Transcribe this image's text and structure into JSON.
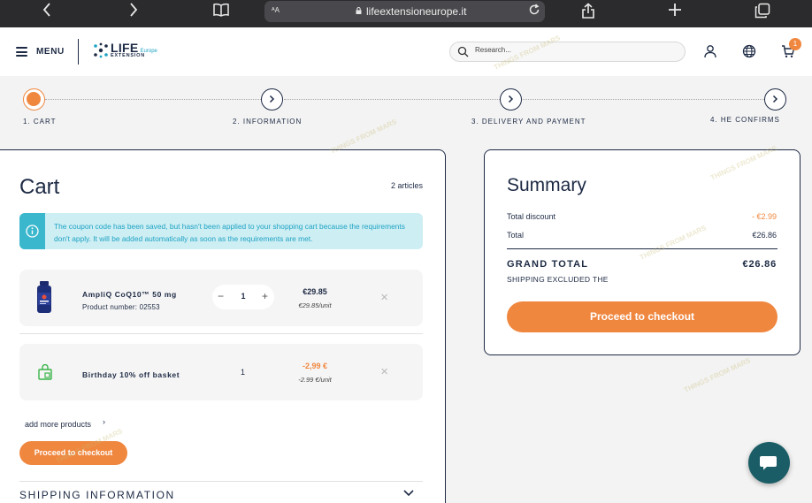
{
  "browser": {
    "url": "lifeextensioneurope.it",
    "aa_label": "ᴬA"
  },
  "header": {
    "menu_label": "MENU",
    "logo_life": "LIFE",
    "logo_europe": "Europe",
    "logo_extension": "EXTENSION",
    "search_placeholder": "Research...",
    "cart_count": "1"
  },
  "stepper": {
    "steps": [
      {
        "label": "1. CART",
        "state": "active"
      },
      {
        "label": "2. INFORMATION",
        "state": "pending"
      },
      {
        "label": "3. DELIVERY AND PAYMENT",
        "state": "pending"
      },
      {
        "label": "4. HE CONFIRMS",
        "state": "pending"
      }
    ]
  },
  "cart": {
    "title": "Cart",
    "articles_count": "2 articles",
    "info_message": "The coupon code has been saved, but hasn't been applied to your shopping cart because the requirements don't apply. It will be added automatically as soon as the requirements are met.",
    "items": [
      {
        "name": "AmpliQ CoQ10™ 50 mg",
        "sub": "Product number: 02553",
        "quantity": "1",
        "price": "€29.85",
        "unit_price": "€29.85/unit",
        "qty_minus": "−",
        "qty_plus": "+",
        "remove": "✕"
      },
      {
        "name": "Birthday 10% off basket",
        "quantity": "1",
        "price": "-2,99 €",
        "unit_price": "-2.99 €/unit",
        "remove": "✕"
      }
    ],
    "add_more": "add more products",
    "add_more_chevron": "›",
    "checkout_label": "Proceed to checkout",
    "shipping_title": "SHIPPING INFORMATION"
  },
  "summary": {
    "title": "Summary",
    "rows": [
      {
        "label": "Total discount",
        "value": "- €2.99"
      },
      {
        "label": "Total",
        "value": "€26.86"
      }
    ],
    "grand_total_label": "GRAND TOTAL",
    "grand_total_value": "€26.86",
    "shipping_note": "SHIPPING EXCLUDED THE",
    "checkout_label": "Proceed to checkout"
  },
  "colors": {
    "accent": "#f0873f",
    "navy": "#1d2a44",
    "info_bg": "#cdeef3",
    "info_text": "#1fa3c4",
    "chat": "#1b5d66"
  },
  "watermark": "THINGS FROM MARS"
}
